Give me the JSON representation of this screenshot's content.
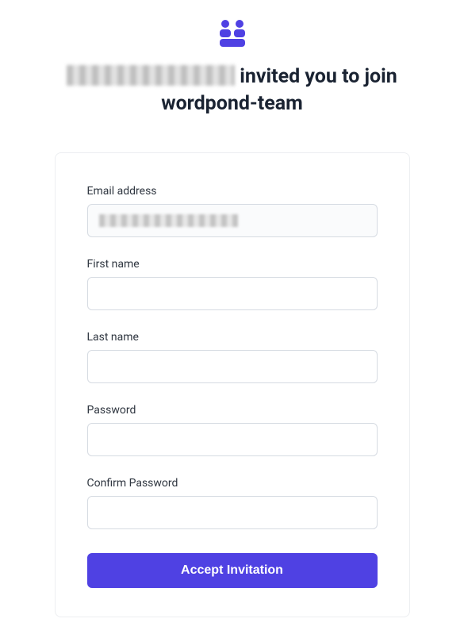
{
  "branding": {
    "logo_color": "#4f41e3"
  },
  "heading": {
    "inviter_name": "",
    "middle_text": "invited you to join",
    "team_name": "wordpond-team"
  },
  "form": {
    "email": {
      "label": "Email address",
      "value": ""
    },
    "first_name": {
      "label": "First name",
      "value": ""
    },
    "last_name": {
      "label": "Last name",
      "value": ""
    },
    "password": {
      "label": "Password",
      "value": ""
    },
    "confirm_password": {
      "label": "Confirm Password",
      "value": ""
    },
    "submit_label": "Accept Invitation"
  }
}
